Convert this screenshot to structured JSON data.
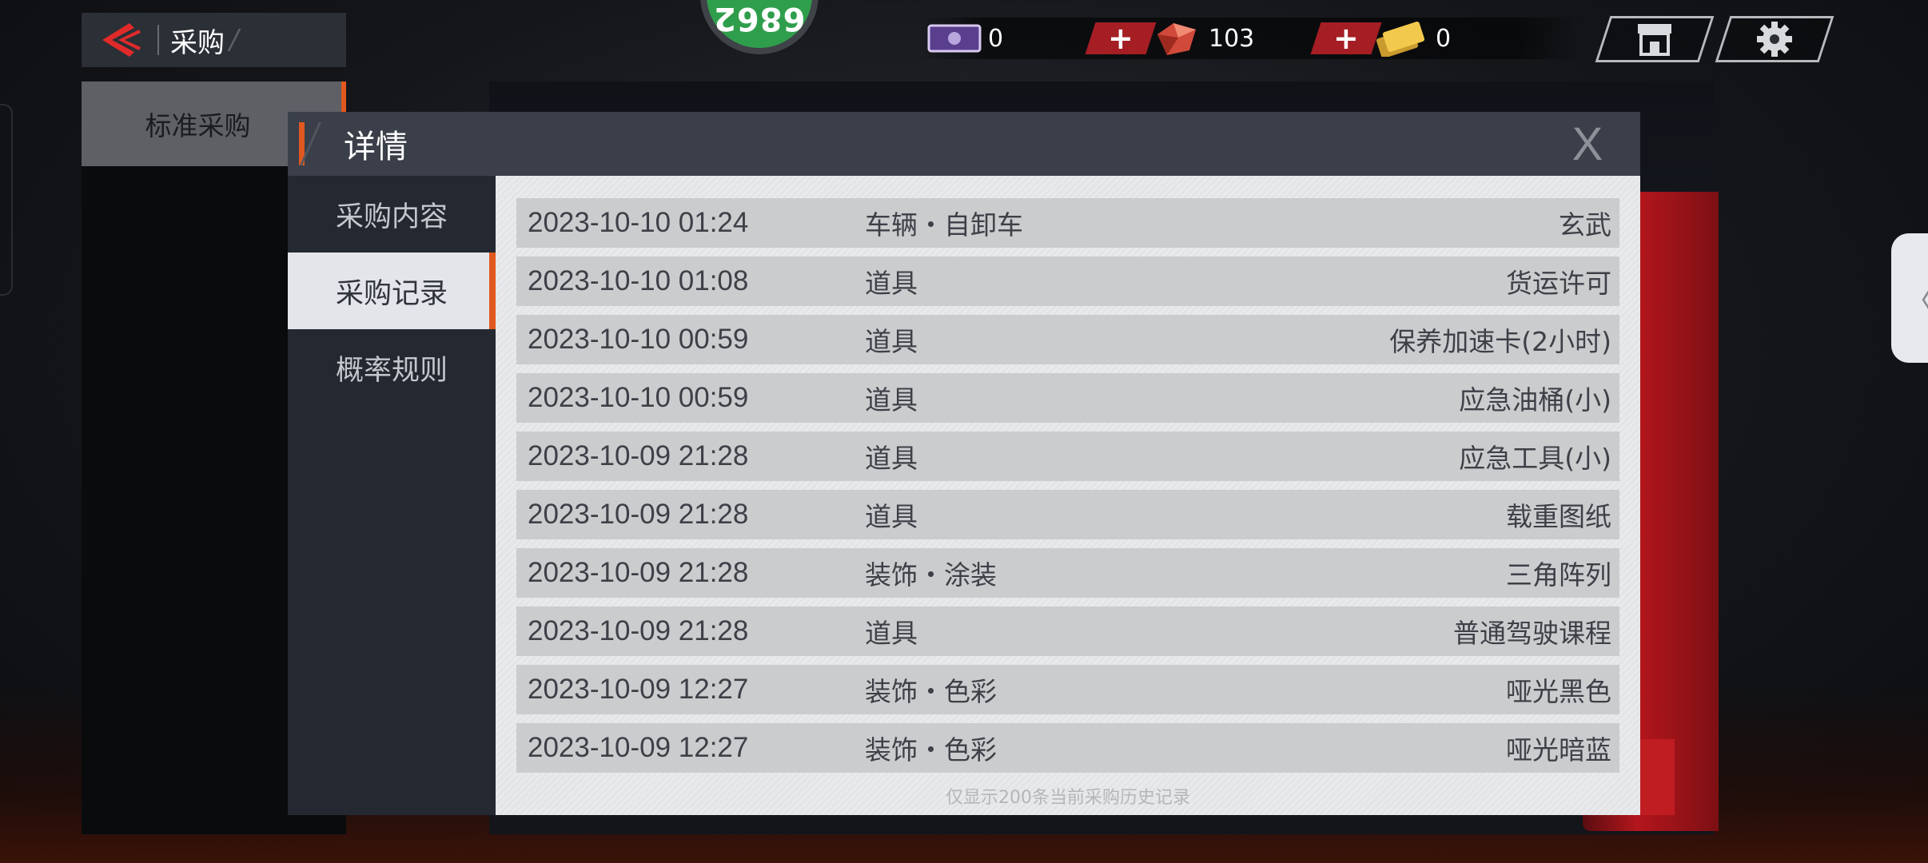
{
  "header": {
    "title": "采购",
    "deco": "/"
  },
  "badge": {
    "text": "6862"
  },
  "currencies": [
    {
      "icon": "ticket-icon",
      "value": "0"
    },
    {
      "icon": "gem-icon",
      "value": "103"
    },
    {
      "icon": "gold-coupon-icon",
      "value": "0"
    }
  ],
  "plus_label": "+",
  "left_panel": {
    "item_label": "标准采购"
  },
  "dialog": {
    "title": "详情",
    "close_label": "X",
    "nav": [
      {
        "label": "采购内容"
      },
      {
        "label": "采购记录"
      },
      {
        "label": "概率规则"
      }
    ],
    "records": [
      {
        "date": "2023-10-10 01:24",
        "type": "车辆・自卸车",
        "item": "玄武"
      },
      {
        "date": "2023-10-10 01:08",
        "type": "道具",
        "item": "货运许可"
      },
      {
        "date": "2023-10-10 00:59",
        "type": "道具",
        "item": "保养加速卡(2小时)"
      },
      {
        "date": "2023-10-10 00:59",
        "type": "道具",
        "item": "应急油桶(小)"
      },
      {
        "date": "2023-10-09 21:28",
        "type": "道具",
        "item": "应急工具(小)"
      },
      {
        "date": "2023-10-09 21:28",
        "type": "道具",
        "item": "载重图纸"
      },
      {
        "date": "2023-10-09 21:28",
        "type": "装饰・涂装",
        "item": "三角阵列"
      },
      {
        "date": "2023-10-09 21:28",
        "type": "道具",
        "item": "普通驾驶课程"
      },
      {
        "date": "2023-10-09 12:27",
        "type": "装饰・色彩",
        "item": "哑光黑色"
      },
      {
        "date": "2023-10-09 12:27",
        "type": "装饰・色彩",
        "item": "哑光暗蓝"
      }
    ],
    "footer": "仅显示200条当前采购历史记录"
  },
  "side_tab": {
    "label": "〈"
  },
  "colors": {
    "accent": "#e0581f",
    "plus_red": "#a41e24",
    "badge_green": "#2f9e4c"
  }
}
